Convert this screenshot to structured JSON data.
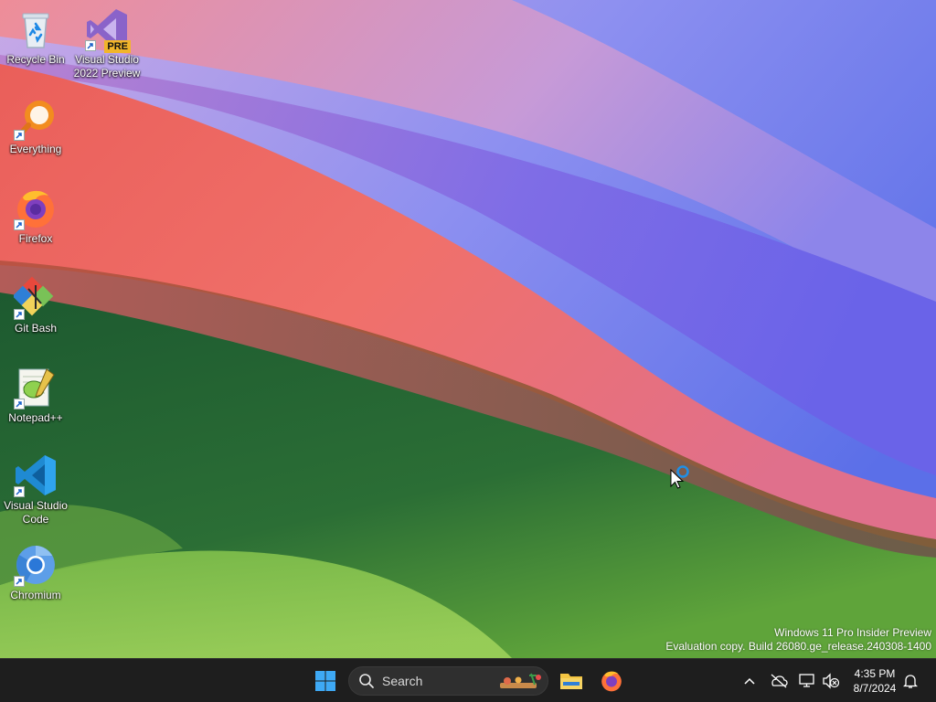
{
  "desktop": {
    "icons": [
      {
        "label": "Recycle Bin",
        "icon": "recycle-bin-icon"
      },
      {
        "label": "Visual Studio 2022 Preview",
        "icon": "visual-studio-icon",
        "badge": "PRE"
      },
      {
        "label": "Everything",
        "icon": "everything-search-icon"
      },
      {
        "label": "Firefox",
        "icon": "firefox-icon"
      },
      {
        "label": "Git Bash",
        "icon": "git-bash-icon"
      },
      {
        "label": "Notepad++",
        "icon": "notepad-plus-plus-icon"
      },
      {
        "label": "Visual Studio Code",
        "icon": "vscode-icon"
      },
      {
        "label": "Chromium",
        "icon": "chromium-icon"
      }
    ]
  },
  "watermark": {
    "line1": "Windows 11 Pro Insider Preview",
    "line2": "Evaluation copy. Build 26080.ge_release.240308-1400"
  },
  "taskbar": {
    "start_icon": "windows-start-icon",
    "search_placeholder": "Search",
    "pinned": [
      {
        "name": "File Explorer",
        "icon": "file-explorer-icon"
      },
      {
        "name": "Firefox",
        "icon": "firefox-icon"
      }
    ],
    "tray": {
      "icons": [
        "chevron-up-icon",
        "onedrive-offline-icon",
        "network-icon",
        "volume-muted-icon"
      ],
      "time": "4:35 PM",
      "date": "8/7/2024",
      "notification_icon": "bell-icon"
    }
  },
  "colors": {
    "taskbar_bg": "#1e1e1e",
    "windows_blue": "#1e90ff",
    "wallpaper_red": "#ef6a64",
    "wallpaper_green": "#1f5e34",
    "wallpaper_purple": "#7c76e8"
  }
}
